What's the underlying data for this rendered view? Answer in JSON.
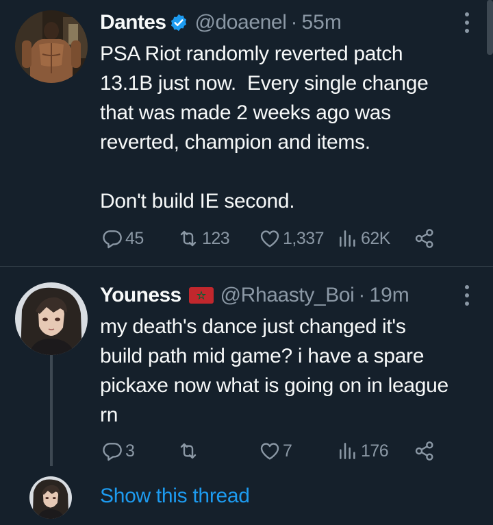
{
  "tweets": [
    {
      "author": "Dantes",
      "handle": "@doaenel",
      "separator": "·",
      "time": "55m",
      "text": "PSA Riot randomly reverted patch\n13.1B just now.  Every single change\nthat was made 2 weeks ago was\nreverted, champion and items.\n\nDon't build IE second.",
      "replies": "45",
      "retweets": "123",
      "likes": "1,337",
      "views": "62K"
    },
    {
      "author": "Youness",
      "handle": "@Rhaasty_Boi",
      "separator": "·",
      "time": "19m",
      "text": "my death's dance just changed it's\nbuild path mid game? i have a spare\npickaxe now what is going on in league\nrn",
      "replies": "3",
      "retweets": "",
      "likes": "7",
      "views": "176"
    }
  ],
  "thread": {
    "link_label": "Show this thread"
  },
  "colors": {
    "background": "#15202b",
    "text": "#f7f9f9",
    "secondary": "#8b98a5",
    "accent": "#1d9bf0",
    "divider": "#38444d"
  },
  "icons": [
    "verified-badge-icon",
    "morocco-flag-icon",
    "more-options-icon",
    "reply-icon",
    "retweet-icon",
    "like-icon",
    "views-icon",
    "share-icon"
  ]
}
